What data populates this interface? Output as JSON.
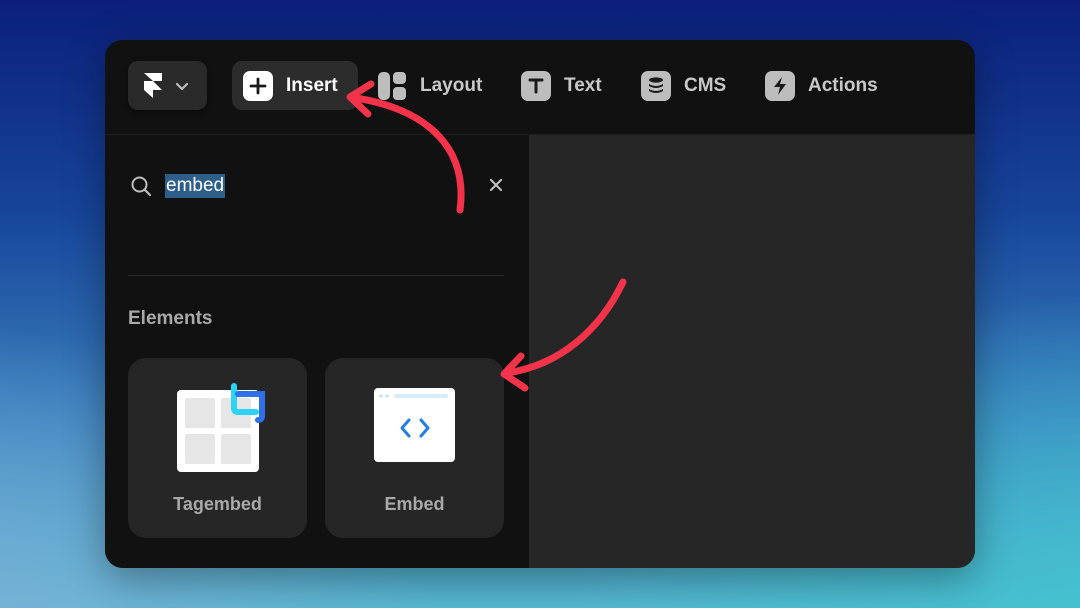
{
  "toolbar": {
    "tabs": [
      {
        "label": "Insert",
        "icon": "plus-icon"
      },
      {
        "label": "Layout",
        "icon": "layout-icon"
      },
      {
        "label": "Text",
        "icon": "text-icon"
      },
      {
        "label": "CMS",
        "icon": "database-icon"
      },
      {
        "label": "Actions",
        "icon": "lightning-icon"
      }
    ],
    "active_tab": "Insert",
    "logo": "framer-logo-icon"
  },
  "search": {
    "value": "embed",
    "icon": "search-icon",
    "clear_icon": "close-icon"
  },
  "elements": {
    "title": "Elements",
    "items": [
      {
        "label": "Tagembed",
        "icon": "tagembed-icon"
      },
      {
        "label": "Embed",
        "icon": "embed-code-icon"
      }
    ]
  },
  "colors": {
    "accent_arrow": "#f2334a",
    "panel_bg": "#111111",
    "canvas_bg": "#262626"
  }
}
